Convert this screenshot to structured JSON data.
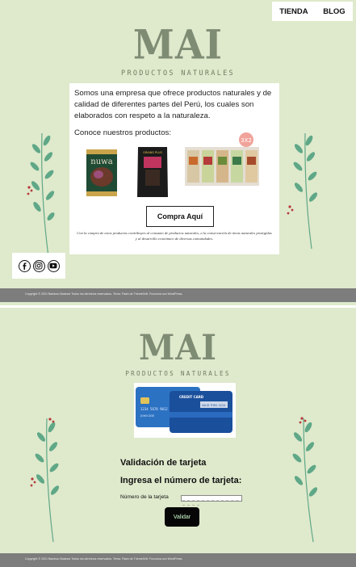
{
  "nav": {
    "items": [
      "TIENDA",
      "BLOG"
    ]
  },
  "brand": {
    "logo": "MAI",
    "tagline": "PRODUCTOS NATURALES"
  },
  "intro": {
    "text": "Somos una empresa que ofrece productos naturales y de calidad de diferentes partes del Perú, los cuales son elaborados con respeto a la naturaleza.",
    "products_lead": "Conoce nuestros productos:"
  },
  "products": [
    {
      "name": "nuwa",
      "icon": "nuwa-jar-image"
    },
    {
      "name": "GRAINS PLUS",
      "icon": "grains-plus-bag-image"
    },
    {
      "badge": "3X2",
      "icon": "snack-bags-image"
    }
  ],
  "cta": {
    "buy_label": "Compra Aquí"
  },
  "commitment": "Con la compra de estos productos contribuyes al consumo de productos naturales, a la conservación de áreas naturales protegidas y al desarrollo económico de diversas comunidades.",
  "social": [
    "facebook-icon",
    "instagram-icon",
    "youtube-icon"
  ],
  "footer": {
    "text": "Copyright © 2021 Bambou Balance Todos los derechos reservados. Tema: Flash de ThemeGrill. Funciona con WordPress."
  },
  "payment": {
    "card_labels": [
      "CREDIT CARD",
      "1234 5678 9012 3456",
      "JOHN DOE",
      "VALID THRU 12/24"
    ],
    "title": "Validación de tarjeta",
    "prompt": "Ingresa el número de tarjeta:",
    "field_label": "Número de la tarjeta",
    "field_value": "_ _ _ _ _ _ _ _ _ _ _ _ _ _ _ _",
    "submit_label": "Validar"
  },
  "colors": {
    "background": "#dfe9cc",
    "logo": "#7f8c74",
    "footer": "#7d7d7d",
    "leaf": "#5fa887",
    "berry": "#b53a3a",
    "button_text": "#d0ffd0"
  }
}
